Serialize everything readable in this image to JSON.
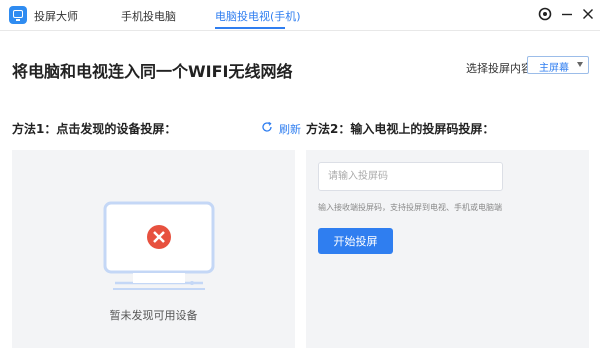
{
  "app": {
    "name": "投屏大师"
  },
  "tabs": [
    {
      "label": "手机投电脑"
    },
    {
      "label": "电脑投电视(手机)"
    }
  ],
  "headline": "将电脑和电视连入同一个WIFI无线网络",
  "content_select": {
    "label": "选择投屏内容:",
    "value": "主屏幕"
  },
  "method1": {
    "title": "方法1：点击发现的设备投屏：",
    "refresh_label": "刷新",
    "empty_text": "暂未发现可用设备"
  },
  "method2": {
    "title": "方法2：输入电视上的投屏码投屏：",
    "input_placeholder": "请输入投屏码",
    "hint": "输入接收端投屏码，支持投屏到电视、手机或电脑端",
    "start_button": "开始投屏"
  },
  "colors": {
    "accent": "#2f7ef0",
    "error": "#e7513f",
    "panel_bg": "#f3f4f6"
  }
}
